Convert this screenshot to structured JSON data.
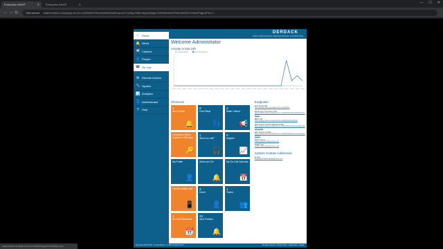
{
  "browser": {
    "tabs": [
      {
        "title": "Enterprise Alert®",
        "active": true
      },
      {
        "title": "Enterprise Alert®",
        "active": false
      }
    ],
    "security": "Not secure",
    "url": "walled.eastus.cloudapp.azure.com/EANG/ShortcutsDefaultLayout?Config=Start.aspx&stage=2&RefreshUrlToken&SSO=ShowPage&Per=1",
    "status_url": "walled.eastus.cloudapp.azure.com/EANG/Pages/OnCallPage.aspx"
  },
  "header": {
    "logo": "DERDACK",
    "tagline": "Faster Incident Response. Reduced Downtimes. Less Work Hours."
  },
  "sidebar": {
    "items": [
      {
        "label": "Home",
        "icon": "home-icon",
        "glyph": "⌂"
      },
      {
        "label": "Alerts",
        "icon": "bell-icon",
        "glyph": "🔔"
      },
      {
        "label": "Callouts",
        "icon": "megaphone-icon",
        "glyph": "📢"
      },
      {
        "label": "People",
        "icon": "person-icon",
        "glyph": "👤"
      },
      {
        "label": "On Call",
        "icon": "oncall-icon",
        "glyph": "☎"
      },
      {
        "label": "Remote Actions",
        "icon": "remote-icon",
        "glyph": "⚙"
      },
      {
        "label": "System",
        "icon": "wrench-icon",
        "glyph": "🔧"
      },
      {
        "label": "Analytics",
        "icon": "chart-icon",
        "glyph": "📊"
      },
      {
        "label": "Administrator",
        "icon": "admin-icon",
        "glyph": "👤"
      },
      {
        "label": "Help",
        "icon": "help-icon",
        "glyph": "?"
      }
    ]
  },
  "main": {
    "welcome": "Welcome Administrator",
    "activity_title": "Activity in last 24h",
    "shortcuts_title": "Shortcuts",
    "endpoints_title": "Endpoints",
    "contact_title": "System Contact Addresses"
  },
  "chart_data": {
    "type": "line",
    "title": "Activity in last 24h",
    "legend": "top-left",
    "series": [
      {
        "name": "Locked Alerts",
        "color": "#9bc2d8",
        "values": [
          0,
          0,
          0,
          0,
          0,
          0,
          0,
          0,
          0,
          0,
          0,
          0,
          0,
          0,
          0,
          0,
          0,
          0,
          0,
          0,
          0,
          0,
          0,
          0,
          0
        ]
      },
      {
        "name": "Incoming Events",
        "color": "#0d5f8c",
        "values": [
          0,
          0,
          0,
          0,
          0,
          0,
          0,
          0,
          0,
          0,
          0,
          0,
          0,
          0,
          0,
          0,
          0,
          0,
          0,
          0,
          0,
          5,
          1,
          2,
          1
        ]
      }
    ],
    "x": [
      "16:00",
      "17:00",
      "18:00",
      "19:00",
      "20:00",
      "21:00",
      "22:00",
      "23:00",
      "00:00",
      "01:00",
      "02:00",
      "03:00",
      "04:00",
      "05:00",
      "06:00",
      "07:00",
      "08:00",
      "09:00",
      "10:00",
      "11:00",
      "12:00",
      "13:00",
      "14:00",
      "15:00",
      "16:00"
    ],
    "ylim": [
      0,
      6
    ],
    "grid": false
  },
  "tiles": [
    {
      "num": "1",
      "label": "Alert Center",
      "color": "orange",
      "icon": "bell-icon",
      "glyph": "🔔"
    },
    {
      "num": "9",
      "label": "First Steps",
      "color": "blue",
      "icon": "footsteps-icon",
      "glyph": "👣"
    },
    {
      "num": "2",
      "label": "Make Callout",
      "color": "blue",
      "icon": "megaphone-icon",
      "glyph": "📢"
    },
    {
      "num": "",
      "label": "Enterprise Edition",
      "sub": "Expires in 290 days",
      "color": "orange",
      "icon": "key-icon",
      "glyph": "🔑"
    },
    {
      "num": "1",
      "label": "Who's on call?",
      "color": "blue",
      "icon": "headset-icon",
      "glyph": "🎧"
    },
    {
      "num": "0",
      "label": "Insights",
      "color": "blue",
      "icon": "chart-icon",
      "glyph": "📈"
    },
    {
      "num": "",
      "label": "My Profile",
      "color": "blue",
      "icon": "person-icon",
      "glyph": "👤"
    },
    {
      "num": "",
      "label": "Alerts are ON",
      "color": "blue",
      "icon": "bell-on-icon",
      "glyph": "🔔"
    },
    {
      "num": "",
      "label": "My On-Call Calendar",
      "color": "blue",
      "icon": "calendar-icon",
      "glyph": "📅"
    },
    {
      "num": "",
      "label": "Get the mobile app!",
      "color": "orange",
      "icon": "phone-icon",
      "glyph": "📱"
    },
    {
      "num": "3",
      "label": "Users",
      "color": "blue",
      "icon": "user-icon",
      "glyph": "👤"
    },
    {
      "num": "1",
      "label": "Teams",
      "color": "blue",
      "icon": "team-icon",
      "glyph": "👥"
    },
    {
      "num": "1",
      "label": "On-Call Schedules",
      "color": "orange",
      "icon": "schedule-icon",
      "glyph": "📆"
    },
    {
      "num": "22",
      "label": "Alert Policies",
      "color": "blue",
      "icon": "policy-icon",
      "glyph": "🔔"
    }
  ],
  "endpoints": [
    {
      "name": "Alert Portal URL",
      "link": "https://walled.eastus.cloudapp.azure.com/EAWeb"
    },
    {
      "name": "Mobile App Connection URL",
      "link": "https://walled.eastus.cloudapp.azure.com/EANG/MobileApp/MobileService.svc"
    },
    {
      "name": "REST API",
      "link": "https://walled.eastus.cloudapp.azure.com/EANG/RestAPI/api"
    },
    {
      "name": "Web Service (SOAP DEPRECATED)",
      "link": "https://walled.eastus.cloudapp.azure.com/EANG/WebServices/EventAPIService.svc"
    },
    {
      "name": "Web Service (SOAP)",
      "link": "https://walled.eastus.cloudapp.azure.com/EANG/WebServices/SoapService.svc"
    },
    {
      "name": "SMTP Server",
      "link": "walled.eastus.cloudapp.azure.com"
    },
    {
      "name": "SNMP Trap",
      "link": "walled.eastus.cloudapp.azure.com"
    }
  ],
  "contact": {
    "label": "E-mail",
    "value": "EA@walled.eastus.cloudapp.azure.com"
  },
  "footer": {
    "left": "Enterprise Alert® 2019 · Trusted Partner · © 2019 Derdack GmbH",
    "right": "All rights reserved · Privacy Policy · Legal Notice · English"
  }
}
